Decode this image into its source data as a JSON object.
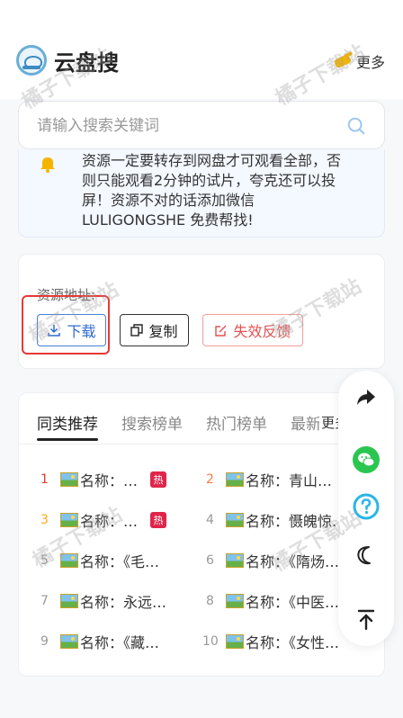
{
  "header": {
    "title": "云盘搜",
    "more_label": "更多"
  },
  "search": {
    "placeholder": "请输入搜索关键词"
  },
  "notice": {
    "text": "资源一定要转存到网盘才可观看全部，否则只能观看2分钟的试片，夸克还可以投屏！资源不对的话添加微信 LULIGONGSHE 免费帮找!"
  },
  "resource": {
    "label": "资源地址:",
    "download_label": "下载",
    "copy_label": "复制",
    "report_label": "失效反馈"
  },
  "tabs": {
    "items": [
      "同类推荐",
      "搜索榜单",
      "热门榜单",
      "最新榜单"
    ],
    "more_label": "更多 ›"
  },
  "ranking": {
    "hot_badge": "热",
    "items": [
      {
        "num": "1",
        "title": "名称：…",
        "hot": true
      },
      {
        "num": "2",
        "title": "名称：青山…",
        "hot": false
      },
      {
        "num": "3",
        "title": "名称：…",
        "hot": true
      },
      {
        "num": "4",
        "title": "名称：慑魄惊…",
        "hot": false
      },
      {
        "num": "5",
        "title": "名称：《毛…",
        "hot": false
      },
      {
        "num": "6",
        "title": "名称：《隋炀…",
        "hot": false
      },
      {
        "num": "7",
        "title": "名称：永远…",
        "hot": false
      },
      {
        "num": "8",
        "title": "名称：《中医…",
        "hot": false
      },
      {
        "num": "9",
        "title": "名称：《藏…",
        "hot": false
      },
      {
        "num": "10",
        "title": "名称：《女性…",
        "hot": false
      }
    ]
  },
  "watermark": {
    "text": "橘子下载站"
  },
  "colors": {
    "accent_blue": "#2f6bd0",
    "report_red": "#e35050",
    "highlight_red": "#e53935",
    "hot_badge": "#e0254a"
  }
}
